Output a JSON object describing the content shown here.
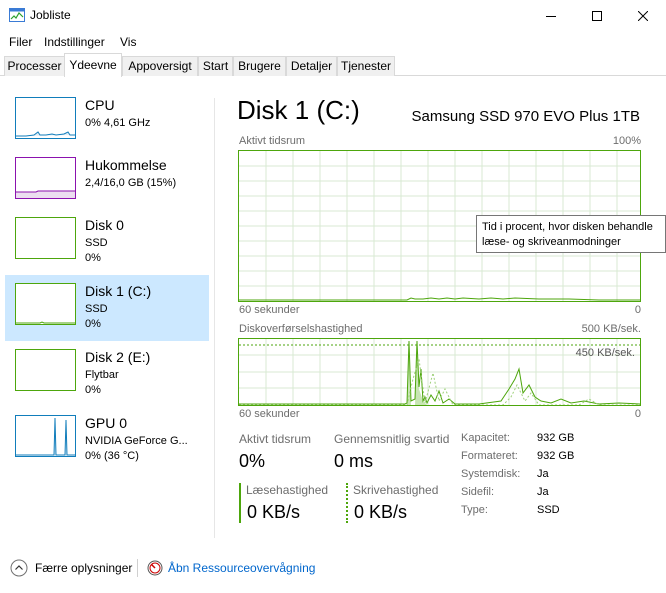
{
  "window": {
    "title": "Jobliste",
    "icon": "task-manager-icon"
  },
  "menu": [
    "Filer",
    "Indstillinger",
    "Vis"
  ],
  "tabs": [
    {
      "label": "Processer",
      "active": false
    },
    {
      "label": "Ydeevne",
      "active": true
    },
    {
      "label": "Appoversigt",
      "active": false
    },
    {
      "label": "Start",
      "active": false
    },
    {
      "label": "Brugere",
      "active": false
    },
    {
      "label": "Detaljer",
      "active": false
    },
    {
      "label": "Tjenester",
      "active": false
    }
  ],
  "sidebar": [
    {
      "name": "CPU",
      "line2": "0% 4,61 GHz",
      "line3": "",
      "color": "#117dbb",
      "selected": false
    },
    {
      "name": "Hukommelse",
      "line2": "2,4/16,0 GB (15%)",
      "line3": "",
      "color": "#8b12ae",
      "selected": false
    },
    {
      "name": "Disk 0",
      "line2": "SSD",
      "line3": "0%",
      "color": "#4da60c",
      "selected": false
    },
    {
      "name": "Disk 1 (C:)",
      "line2": "SSD",
      "line3": "0%",
      "color": "#4da60c",
      "selected": true
    },
    {
      "name": "Disk 2 (E:)",
      "line2": "Flytbar",
      "line3": "0%",
      "color": "#4da60c",
      "selected": false
    },
    {
      "name": "GPU 0",
      "line2": "NVIDIA GeForce G...",
      "line3": "0% (36 °C)",
      "color": "#117dbb",
      "selected": false
    }
  ],
  "main": {
    "title": "Disk 1 (C:)",
    "model": "Samsung SSD 970 EVO Plus 1TB",
    "graph1": {
      "label": "Aktivt tidsrum",
      "max": "100%",
      "time": "60 sekunder",
      "min": "0"
    },
    "graph2": {
      "label": "Diskoverførselshastighed",
      "max": "500 KB/sek.",
      "mark": "450 KB/sek.",
      "time": "60 sekunder",
      "min": "0"
    },
    "stats": {
      "active_label": "Aktivt tidsrum",
      "active_value": "0%",
      "response_label": "Gennemsnitlig svartid",
      "response_value": "0 ms",
      "read_label": "Læsehastighed",
      "read_value": "0 KB/s",
      "write_label": "Skrivehastighed",
      "write_value": "0 KB/s"
    },
    "properties": [
      {
        "label": "Kapacitet:",
        "value": "932 GB"
      },
      {
        "label": "Formateret:",
        "value": "932 GB"
      },
      {
        "label": "Systemdisk:",
        "value": "Ja"
      },
      {
        "label": "Sidefil:",
        "value": "Ja"
      },
      {
        "label": "Type:",
        "value": "SSD"
      }
    ]
  },
  "tooltip": {
    "line1": "Tid i procent, hvor disken behandle",
    "line2": "læse- og skriveanmodninger"
  },
  "footer": {
    "fewer_details": "Færre oplysninger",
    "resource_monitor": "Åbn Ressourceovervågning"
  },
  "colors": {
    "disk": "#4da60c",
    "cpu": "#117dbb",
    "memory": "#8b12ae",
    "selected": "#cce8ff"
  }
}
